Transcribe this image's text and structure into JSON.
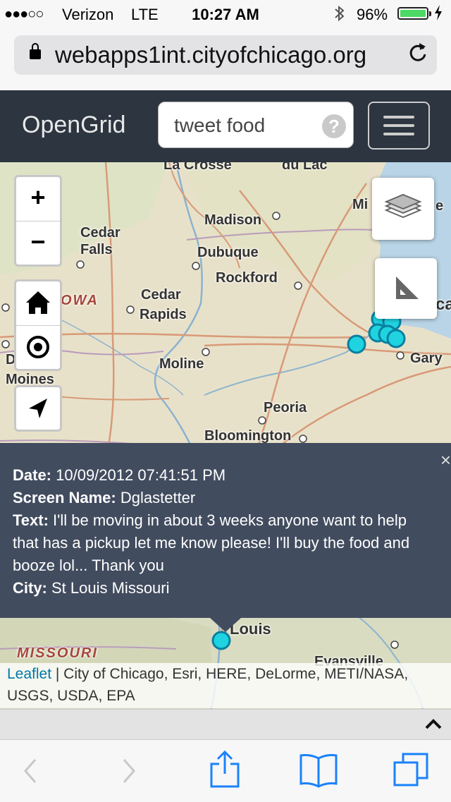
{
  "status_bar": {
    "signal": "●●●○○",
    "carrier": "Verizon",
    "network": "LTE",
    "time": "10:27 AM",
    "bluetooth_icon": "bluetooth-icon",
    "battery": "96%",
    "battery_level": 0.96,
    "battery_color": "#4cd964"
  },
  "browser": {
    "url": "webapps1int.cityofchicago.org",
    "lock_icon": "lock-icon",
    "reload_icon": "reload-icon"
  },
  "app": {
    "brand": "OpenGrid",
    "search_value": "tweet food",
    "help_label": "?",
    "header_color": "#2c3540"
  },
  "map": {
    "labels": {
      "la_crosse": "La Crosse",
      "green_bay": "du Lac",
      "madison": "Madison",
      "milwaukee": "Mi",
      "cedar_falls_1": "Cedar",
      "cedar_falls_2": "Falls",
      "dubuque": "Dubuque",
      "rockford": "Rockford",
      "iowa": "OWA",
      "cedar_rapids_1": "Cedar",
      "cedar_rapids_2": "Rapids",
      "chicago": "ca",
      "moline": "Moline",
      "gary": "Gary",
      "des_moines_1": "D",
      "des_moines_2": "Moines",
      "peoria": "Peoria",
      "bloomington": "Bloomington",
      "st_louis": "Louis",
      "missouri": "MISSOURI",
      "evansville": "Evansville",
      "right_edge": "e"
    },
    "controls": {
      "zoom_in": "+",
      "zoom_out": "−",
      "home_icon": "home-icon",
      "locate_icon": "target-icon",
      "navigate_icon": "navigation-arrow-icon",
      "layers_icon": "layers-icon",
      "measure_icon": "ruler-triangle-icon"
    },
    "marker_color": "#1fd3e0"
  },
  "popup": {
    "date_label": "Date:",
    "date_value": " 10/09/2012 07:41:51 PM",
    "screen_name_label": "Screen Name:",
    "screen_name_value": " Dglastetter",
    "text_label": "Text:",
    "text_value": " I'll be moving in about 3 weeks anyone want to help that has a pickup let me know please! I'll buy the food and booze lol... Thank you",
    "city_label": "City:",
    "city_value": " St Louis Missouri",
    "close": "×",
    "bg_color": "#424c5f"
  },
  "attribution": {
    "leaflet": "Leaflet",
    "sources": " | City of Chicago, Esri, HERE, DeLorme, METI/NASA, USGS, USDA, EPA"
  },
  "expander": {
    "chevron_icon": "chevron-up-icon"
  },
  "toolbar": {
    "back_icon": "back-chevron-icon",
    "forward_icon": "forward-chevron-icon",
    "share_icon": "share-icon",
    "bookmarks_icon": "book-icon",
    "tabs_icon": "tabs-icon",
    "tint": "#1a82fb"
  }
}
